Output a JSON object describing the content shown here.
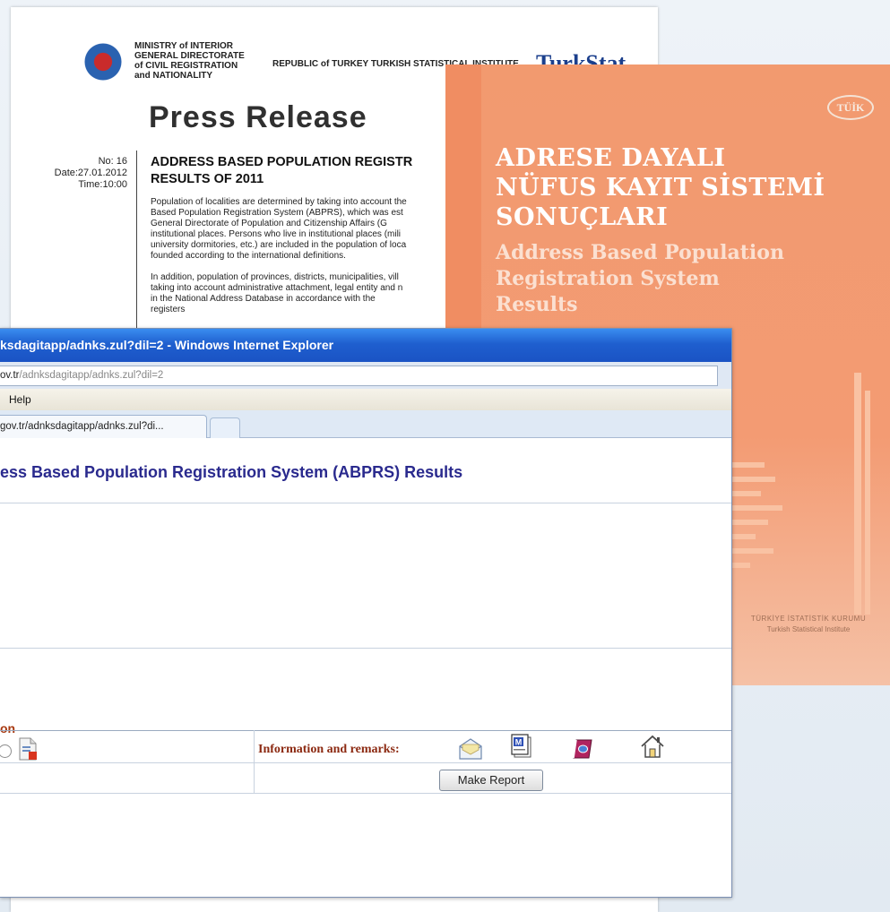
{
  "press_release": {
    "ministry": "MINISTRY of INTERIOR\nGENERAL DIRECTORATE\nof CIVIL REGISTRATION\nand NATIONALITY",
    "republic": "REPUBLIC of TURKEY TURKISH STATISTICAL INSTITUTE",
    "brand": "TurkStat",
    "title": "Press Release",
    "meta": "No: 16\nDate:27.01.2012\nTime:10:00",
    "headline": "ADDRESS BASED POPULATION REGISTR\nRESULTS OF 2011",
    "body": "Population of localities are determined by taking into account the\nBased Population Registration System (ABPRS), which was est\nGeneral Directorate of Population and Citizenship Affairs (G\ninstitutional places. Persons who live in institutional places (mili\nuniversity dormitories, etc.) are included in the population of loca\nfounded according to the international definitions.\n\nIn addition, population of provinces, districts, municipalities, vill\ntaking into account administrative attachment, legal entity and n\nin the National Address Database in accordance with the\nregisters"
  },
  "cover": {
    "badge": "TÜİK",
    "title_tr": "ADRESE DAYALI\nNÜFUS KAYIT SİSTEMİ\nSONUÇLARI",
    "title_en": "Address Based Population\nRegistration System\nResults",
    "footer_tr": "TÜRKİYE İSTATİSTİK KURUMU",
    "footer_en": "Turkish Statistical Institute",
    "accent": "#f29a6f"
  },
  "browser": {
    "title": "ksdagitapp/adnks.zul?dil=2 - Windows Internet Explorer",
    "address_domain": "ov.tr",
    "address_path": "/adnksdagitapp/adnks.zul?dil=2",
    "menu_help": "Help",
    "tab_label": "gov.tr/adnksdagitapp/adnks.zul?di...",
    "page_title": "ess Based Population Registration System (ABPRS) Results",
    "fragment_on": "on",
    "info_label": "Information and remarks:",
    "report_button": "Make Report",
    "title_color": "#1f5fcf"
  },
  "icons": [
    "document-chart-icon",
    "envelope-icon",
    "m-document-icon",
    "book-icon",
    "home-icon"
  ]
}
